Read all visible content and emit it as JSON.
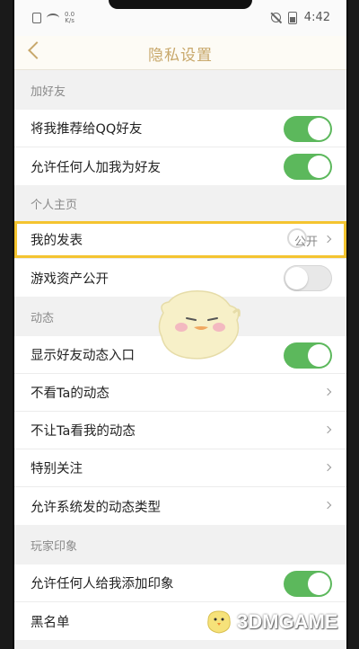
{
  "status_bar": {
    "network_speed_top": "0.0",
    "network_speed_bottom": "K/s",
    "battery": "",
    "time": "4:42"
  },
  "nav": {
    "title": "隐私设置"
  },
  "sections": [
    {
      "header": "加好友",
      "rows": [
        {
          "label": "将我推荐给QQ好友",
          "control": "toggle",
          "on": true
        },
        {
          "label": "允许任何人加我为好友",
          "control": "toggle",
          "on": true
        }
      ]
    },
    {
      "header": "个人主页",
      "rows": [
        {
          "label": "我的发表",
          "control": "chevron",
          "value": "公开",
          "highlighted": true
        },
        {
          "label": "游戏资产公开",
          "control": "toggle",
          "on": false
        }
      ]
    },
    {
      "header": "动态",
      "rows": [
        {
          "label": "显示好友动态入口",
          "control": "toggle",
          "on": true
        },
        {
          "label": "不看Ta的动态",
          "control": "chevron"
        },
        {
          "label": "不让Ta看我的动态",
          "control": "chevron"
        },
        {
          "label": "特别关注",
          "control": "chevron"
        },
        {
          "label": "允许系统发的动态类型",
          "control": "chevron"
        }
      ]
    },
    {
      "header": "玩家印象",
      "rows": [
        {
          "label": "允许任何人给我添加印象",
          "control": "toggle",
          "on": true
        },
        {
          "label": "黑名单",
          "control": "chevron"
        }
      ]
    }
  ],
  "watermark": {
    "text": "3DMGAME"
  },
  "colors": {
    "accent": "#c8a86b",
    "toggle_on": "#5cb85c",
    "highlight": "#f4c430"
  }
}
